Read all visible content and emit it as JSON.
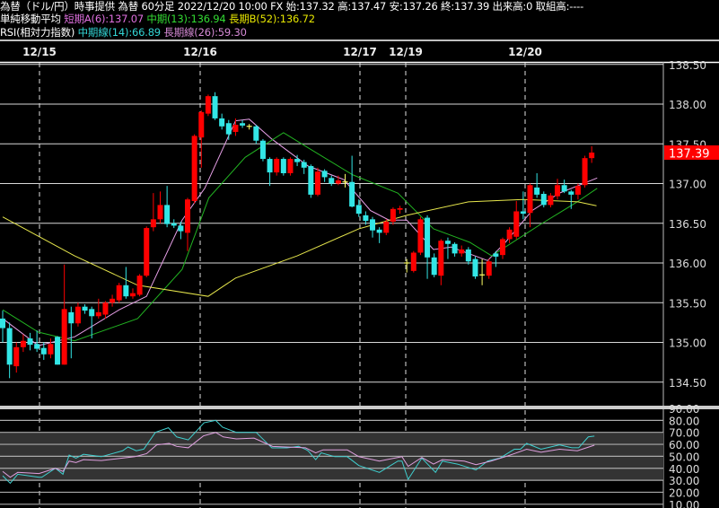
{
  "header": {
    "line1": "為替（ドル/円）時事提供 為替 60分足 2022/12/20 10:00 FX 始:137.32 高:137.47 安:137.26 終:137.39 出来高:0 取組高:----",
    "ma_title": "単純移動平均",
    "ma_short": "短期A(6):137.07",
    "ma_mid": "中期(13):136.94",
    "ma_long": "長期B(52):136.72",
    "rsi_title": "RSI(相対力指数)",
    "rsi_mid": "中期線(14):66.89",
    "rsi_long": "長期線(26):59.30"
  },
  "colors": {
    "up": "#ff0000",
    "down": "#33e6e6",
    "doji": "#ffff66",
    "ma_short": "#e8a0e8",
    "ma_mid": "#22b422",
    "ma_long": "#e6e64c",
    "rsi_mid": "#40d0d0",
    "rsi_long": "#e0a0e0",
    "grid": "#d8d8d8",
    "rsi_band": "#333333",
    "last_price_bg": "#ff0000"
  },
  "chart_data": [
    {
      "type": "candlestick",
      "dates": [
        "12/15",
        "12/16",
        "12/17",
        "12/19",
        "12/20"
      ],
      "ylim": [
        134.5,
        138.5
      ],
      "yticks": [
        "138.50",
        "138.00",
        "137.50",
        "137.00",
        "136.50",
        "136.00",
        "135.50",
        "135.00",
        "134.50"
      ],
      "last_price": "137.39",
      "ohlc": [
        [
          135.3,
          135.4,
          135.0,
          135.18
        ],
        [
          135.18,
          135.25,
          134.55,
          134.72
        ],
        [
          134.7,
          135.0,
          134.62,
          134.94
        ],
        [
          134.94,
          135.1,
          134.88,
          135.02
        ],
        [
          135.05,
          135.12,
          134.9,
          134.97
        ],
        [
          134.98,
          135.15,
          134.88,
          134.92
        ],
        [
          134.93,
          135.0,
          134.78,
          134.85
        ],
        [
          134.85,
          135.05,
          134.8,
          134.98
        ],
        [
          135.07,
          135.08,
          134.72,
          134.72
        ],
        [
          134.72,
          135.98,
          134.72,
          135.42
        ],
        [
          135.38,
          135.45,
          134.8,
          135.24
        ],
        [
          135.24,
          135.5,
          135.2,
          135.45
        ],
        [
          135.45,
          135.48,
          135.36,
          135.4
        ],
        [
          135.42,
          135.45,
          135.05,
          135.33
        ],
        [
          135.33,
          135.55,
          135.3,
          135.38
        ],
        [
          135.35,
          135.52,
          135.3,
          135.5
        ],
        [
          135.5,
          135.6,
          135.45,
          135.55
        ],
        [
          135.53,
          135.75,
          135.5,
          135.72
        ],
        [
          135.72,
          135.95,
          135.55,
          135.58
        ],
        [
          135.58,
          135.68,
          135.55,
          135.62
        ],
        [
          135.6,
          135.86,
          135.58,
          135.84
        ],
        [
          135.84,
          136.46,
          135.82,
          136.44
        ],
        [
          136.45,
          136.88,
          136.4,
          136.55
        ],
        [
          136.55,
          136.9,
          136.5,
          136.73
        ],
        [
          136.73,
          136.97,
          136.45,
          136.49
        ],
        [
          136.5,
          136.55,
          136.44,
          136.47
        ],
        [
          136.47,
          136.52,
          136.3,
          136.4
        ],
        [
          136.38,
          136.82,
          136.15,
          136.8
        ],
        [
          136.78,
          137.62,
          136.75,
          137.6
        ],
        [
          137.58,
          137.92,
          137.2,
          137.9
        ],
        [
          137.88,
          138.12,
          137.85,
          138.1
        ],
        [
          138.1,
          138.15,
          137.8,
          137.82
        ],
        [
          137.82,
          137.88,
          137.68,
          137.72
        ],
        [
          137.76,
          137.8,
          137.55,
          137.62
        ],
        [
          137.65,
          137.82,
          137.6,
          137.74
        ],
        [
          137.76,
          137.8,
          137.7,
          137.73
        ],
        [
          137.72,
          137.75,
          137.68,
          137.72
        ],
        [
          137.72,
          137.74,
          137.5,
          137.54
        ],
        [
          137.54,
          137.56,
          137.28,
          137.31
        ],
        [
          137.31,
          137.33,
          136.97,
          137.14
        ],
        [
          137.14,
          137.33,
          137.1,
          137.31
        ],
        [
          137.31,
          137.33,
          137.1,
          137.13
        ],
        [
          137.13,
          137.33,
          137.1,
          137.31
        ],
        [
          137.31,
          137.36,
          137.22,
          137.27
        ],
        [
          137.27,
          137.3,
          137.12,
          137.2
        ],
        [
          137.22,
          137.24,
          136.82,
          136.86
        ],
        [
          136.86,
          137.2,
          136.84,
          137.15
        ],
        [
          137.16,
          137.18,
          137.02,
          137.08
        ],
        [
          137.07,
          137.1,
          136.97,
          137.0
        ],
        [
          137.0,
          137.1,
          136.98,
          137.04
        ],
        [
          137.02,
          137.12,
          136.95,
          137.02
        ],
        [
          137.02,
          137.35,
          136.7,
          136.71
        ],
        [
          136.73,
          136.8,
          136.58,
          136.62
        ],
        [
          136.6,
          136.65,
          136.48,
          136.53
        ],
        [
          136.55,
          136.58,
          136.32,
          136.41
        ],
        [
          136.42,
          136.45,
          136.25,
          136.38
        ],
        [
          136.38,
          136.55,
          136.35,
          136.52
        ],
        [
          136.52,
          136.7,
          136.48,
          136.68
        ],
        [
          136.67,
          136.72,
          136.62,
          136.69
        ],
        [
          136.0,
          136.05,
          135.88,
          136.0
        ],
        [
          135.9,
          136.15,
          135.88,
          136.13
        ],
        [
          136.13,
          136.58,
          136.1,
          136.55
        ],
        [
          136.57,
          136.6,
          135.8,
          136.07
        ],
        [
          136.07,
          136.12,
          135.82,
          135.85
        ],
        [
          135.84,
          136.3,
          135.72,
          136.28
        ],
        [
          136.28,
          136.32,
          136.05,
          136.24
        ],
        [
          136.24,
          136.26,
          136.08,
          136.12
        ],
        [
          136.12,
          136.22,
          136.08,
          136.17
        ],
        [
          136.17,
          136.2,
          135.98,
          136.02
        ],
        [
          136.05,
          136.08,
          135.8,
          135.83
        ],
        [
          135.85,
          136.05,
          135.72,
          135.85
        ],
        [
          135.84,
          136.05,
          135.8,
          136.02
        ],
        [
          136.12,
          136.15,
          135.95,
          136.08
        ],
        [
          136.1,
          136.32,
          136.05,
          136.3
        ],
        [
          136.3,
          136.45,
          136.25,
          136.42
        ],
        [
          136.33,
          136.78,
          136.3,
          136.65
        ],
        [
          136.65,
          136.9,
          136.55,
          136.62
        ],
        [
          136.63,
          137.0,
          136.45,
          136.98
        ],
        [
          136.95,
          137.13,
          136.82,
          136.86
        ],
        [
          136.87,
          136.9,
          136.7,
          136.73
        ],
        [
          136.73,
          136.88,
          136.7,
          136.85
        ],
        [
          136.84,
          137.06,
          136.8,
          136.98
        ],
        [
          136.98,
          137.05,
          136.88,
          136.9
        ],
        [
          136.9,
          136.92,
          136.68,
          136.86
        ],
        [
          136.86,
          137.0,
          136.8,
          136.97
        ],
        [
          136.98,
          137.35,
          136.95,
          137.32
        ],
        [
          137.32,
          137.47,
          137.26,
          137.39
        ]
      ],
      "series": [
        {
          "name": "短期A(6)",
          "points": [
            [
              0,
              135.3
            ],
            [
              5.2,
              134.96
            ],
            [
              10.5,
              135.07
            ],
            [
              17,
              135.41
            ],
            [
              21,
              135.58
            ],
            [
              26.2,
              136.54
            ],
            [
              29.5,
              136.94
            ],
            [
              34,
              137.79
            ],
            [
              36,
              137.81
            ],
            [
              39.3,
              137.56
            ],
            [
              44.6,
              137.22
            ],
            [
              49.8,
              137.05
            ],
            [
              53.7,
              136.66
            ],
            [
              56.4,
              136.54
            ],
            [
              59,
              136.54
            ],
            [
              62.9,
              136.17
            ],
            [
              65.5,
              136.2
            ],
            [
              70.8,
              136.03
            ],
            [
              73.4,
              136.26
            ],
            [
              77.3,
              136.66
            ],
            [
              81.3,
              136.88
            ],
            [
              86.8,
              137.07
            ]
          ]
        },
        {
          "name": "中期(13)",
          "points": [
            [
              0,
              135.41
            ],
            [
              5.2,
              135.13
            ],
            [
              10.5,
              135.02
            ],
            [
              19.7,
              135.3
            ],
            [
              26.2,
              135.92
            ],
            [
              30.1,
              136.82
            ],
            [
              35.4,
              137.33
            ],
            [
              41,
              137.64
            ],
            [
              44.6,
              137.45
            ],
            [
              51.1,
              137.11
            ],
            [
              57.7,
              136.88
            ],
            [
              62.9,
              136.43
            ],
            [
              68.2,
              136.26
            ],
            [
              71.4,
              136.09
            ],
            [
              78.6,
              136.49
            ],
            [
              83.9,
              136.77
            ],
            [
              86.8,
              136.94
            ]
          ]
        },
        {
          "name": "長期B(52)",
          "points": [
            [
              0,
              136.58
            ],
            [
              10.5,
              136.09
            ],
            [
              19.7,
              135.72
            ],
            [
              30,
              135.58
            ],
            [
              34,
              135.81
            ],
            [
              43,
              136.09
            ],
            [
              52,
              136.43
            ],
            [
              59,
              136.6
            ],
            [
              68,
              136.77
            ],
            [
              76,
              136.8
            ],
            [
              84,
              136.77
            ],
            [
              86.7,
              136.72
            ]
          ]
        }
      ]
    },
    {
      "type": "line",
      "title": "RSI(相対力指数)",
      "ylim": [
        10,
        90
      ],
      "yticks": [
        "90.00",
        "80.00",
        "70.00",
        "60.00",
        "50.00",
        "40.00",
        "30.00",
        "20.00",
        "10.00"
      ],
      "band": [
        30,
        70
      ],
      "series": [
        {
          "name": "中期線(14)",
          "points": [
            [
              0,
              33.7
            ],
            [
              1.1,
              27.5
            ],
            [
              2.2,
              35
            ],
            [
              5.3,
              32.5
            ],
            [
              5.7,
              32.5
            ],
            [
              7.7,
              40
            ],
            [
              8.8,
              35
            ],
            [
              9.7,
              51
            ],
            [
              10.7,
              48.5
            ],
            [
              11.8,
              51.7
            ],
            [
              14.4,
              49.7
            ],
            [
              17.5,
              54.6
            ],
            [
              18.3,
              57.8
            ],
            [
              19.5,
              54.6
            ],
            [
              20.6,
              56
            ],
            [
              22.3,
              70
            ],
            [
              24.2,
              73.8
            ],
            [
              25.4,
              66.2
            ],
            [
              27.1,
              63.7
            ],
            [
              29.4,
              78
            ],
            [
              31.1,
              80
            ],
            [
              32.1,
              74.3
            ],
            [
              34.1,
              70
            ],
            [
              37,
              70
            ],
            [
              39.3,
              57
            ],
            [
              41.5,
              57
            ],
            [
              43.2,
              58.3
            ],
            [
              44.2,
              55.9
            ],
            [
              44.6,
              54.6
            ],
            [
              45.7,
              47.2
            ],
            [
              46.5,
              52.9
            ],
            [
              48.5,
              49.7
            ],
            [
              50.3,
              49.7
            ],
            [
              52,
              42.3
            ],
            [
              55,
              36.6
            ],
            [
              57.7,
              46
            ],
            [
              58.3,
              46
            ],
            [
              59.2,
              30.7
            ],
            [
              61.2,
              48.5
            ],
            [
              63.2,
              36.6
            ],
            [
              64.2,
              46
            ],
            [
              66.4,
              43.5
            ],
            [
              69.1,
              38.6
            ],
            [
              70.8,
              46
            ],
            [
              72.6,
              48.5
            ],
            [
              74.7,
              55.9
            ],
            [
              75.6,
              55.9
            ],
            [
              76.5,
              60.8
            ],
            [
              78.6,
              55.9
            ],
            [
              81.3,
              59.6
            ],
            [
              83.1,
              57.1
            ],
            [
              84.1,
              57.1
            ],
            [
              85.5,
              66.2
            ],
            [
              86.4,
              66.89
            ]
          ]
        },
        {
          "name": "長期線(26)",
          "points": [
            [
              0,
              37.4
            ],
            [
              1.1,
              32.5
            ],
            [
              2.2,
              36.6
            ],
            [
              5.3,
              35.6
            ],
            [
              7.7,
              40
            ],
            [
              8.8,
              37.4
            ],
            [
              9.7,
              46
            ],
            [
              10.7,
              44.8
            ],
            [
              11.8,
              47.2
            ],
            [
              14.4,
              46.5
            ],
            [
              17.5,
              48.5
            ],
            [
              19.3,
              49.7
            ],
            [
              21,
              52.2
            ],
            [
              22.5,
              59.6
            ],
            [
              24.3,
              60.8
            ],
            [
              25.4,
              58.3
            ],
            [
              27.1,
              57.1
            ],
            [
              29.3,
              67
            ],
            [
              31.1,
              69.9
            ],
            [
              32.2,
              66.2
            ],
            [
              34.1,
              64.5
            ],
            [
              36.7,
              65.2
            ],
            [
              39.4,
              58.3
            ],
            [
              44.2,
              57.1
            ],
            [
              45.7,
              52.9
            ],
            [
              46.8,
              55.4
            ],
            [
              50.3,
              55.4
            ],
            [
              52,
              49.7
            ],
            [
              55,
              46
            ],
            [
              58.3,
              49.7
            ],
            [
              59.2,
              41.6
            ],
            [
              61.2,
              49
            ],
            [
              62.9,
              43.5
            ],
            [
              64.2,
              47.2
            ],
            [
              67.4,
              46
            ],
            [
              69.1,
              43
            ],
            [
              71.3,
              46
            ],
            [
              73.4,
              49.7
            ],
            [
              74.7,
              52.2
            ],
            [
              76.5,
              55.9
            ],
            [
              78.6,
              53.4
            ],
            [
              81.3,
              55.9
            ],
            [
              83.9,
              54.6
            ],
            [
              86.4,
              59.3
            ]
          ]
        }
      ]
    }
  ]
}
